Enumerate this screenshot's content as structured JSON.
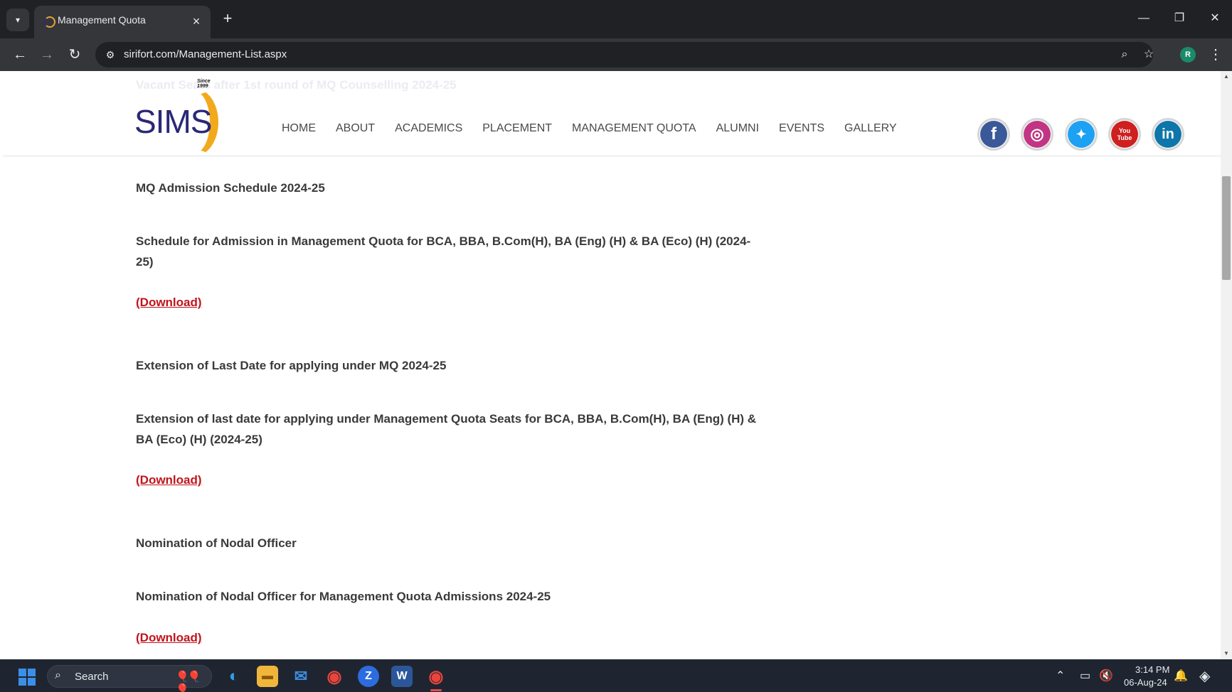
{
  "browser": {
    "tab_title": "Management Quota",
    "url": "sirifort.com/Management-List.aspx",
    "profile_initial": "R",
    "colors": {
      "chrome_dark": "#202124",
      "chrome_toolbar": "#35363a"
    }
  },
  "site": {
    "logo_text": "SIMS",
    "logo_since": "Since 1999",
    "behind_heading": "Vacant Seats after 1st round of MQ Counselling 2024-25",
    "nav": [
      "HOME",
      "ABOUT",
      "ACADEMICS",
      "PLACEMENT",
      "MANAGEMENT QUOTA",
      "ALUMNI",
      "EVENTS",
      "GALLERY"
    ],
    "social": [
      {
        "name": "facebook-icon",
        "glyph": "f",
        "color": "#3b5998"
      },
      {
        "name": "instagram-icon",
        "glyph": "◎",
        "color": "#c13584"
      },
      {
        "name": "twitter-icon",
        "glyph": "🐦",
        "color": "#1da1f2"
      },
      {
        "name": "youtube-icon",
        "glyph": "You Tube",
        "color": "#cd201f"
      },
      {
        "name": "linkedin-icon",
        "glyph": "in",
        "color": "#0e76a8"
      }
    ],
    "colors": {
      "brand_blue": "#2a2876",
      "brand_orange": "#f2a91c",
      "download_red": "#c0141b"
    }
  },
  "notices": [
    {
      "heading": "MQ Admission Schedule 2024-25",
      "text": "Schedule for Admission in Management Quota for BCA, BBA, B.Com(H), BA (Eng) (H) & BA (Eco) (H) (2024-25)",
      "link": "(Download)"
    },
    {
      "heading": "Extension of Last Date for applying under MQ 2024-25",
      "text": "Extension of last date for applying under Management Quota Seats for BCA, BBA, B.Com(H), BA (Eng) (H) & BA (Eco) (H) (2024-25)",
      "link": "(Download)"
    },
    {
      "heading": "Nomination of Nodal Officer",
      "text": "Nomination of Nodal Officer for Management Quota Admissions 2024-25",
      "link": "(Download)"
    }
  ],
  "taskbar": {
    "search_label": "Search",
    "time": "3:14 PM",
    "date": "06-Aug-24"
  }
}
